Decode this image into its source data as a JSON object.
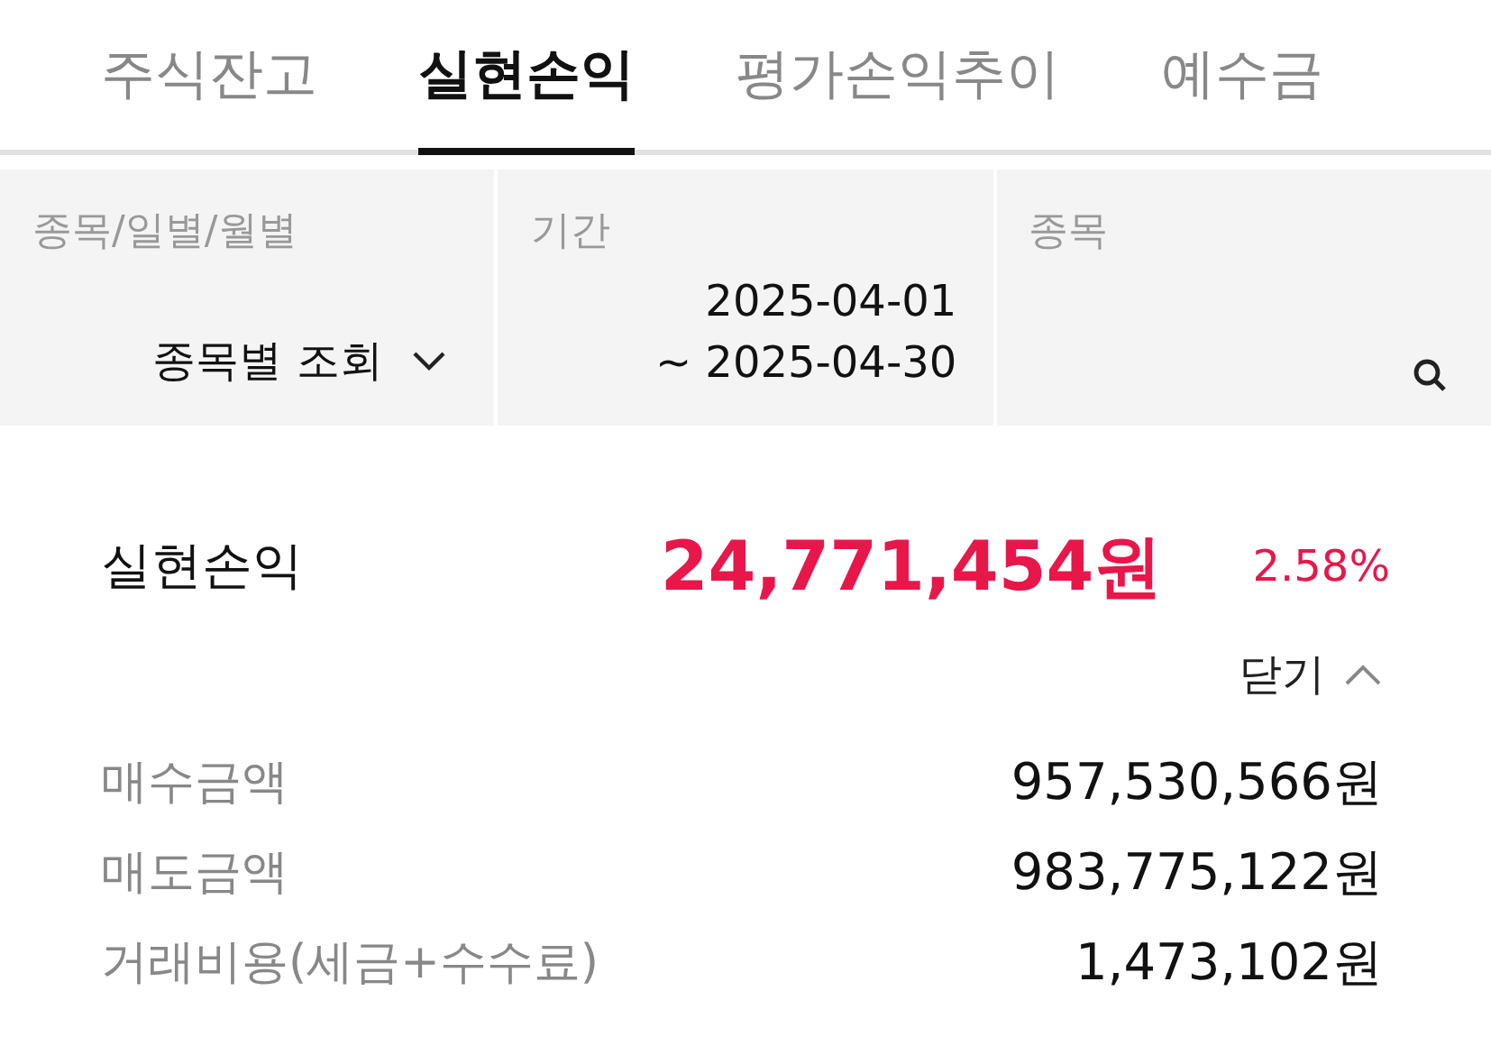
{
  "tabs": [
    {
      "label": "주식잔고",
      "selected": false
    },
    {
      "label": "실현손익",
      "selected": true
    },
    {
      "label": "평가손익추이",
      "selected": false
    },
    {
      "label": "예수금",
      "selected": false
    }
  ],
  "filters": [
    {
      "kind": "dropdown",
      "label": "종목/일별/월별",
      "value": "종목별 조회"
    },
    {
      "kind": "period",
      "label": "기간",
      "start": "2025-04-01",
      "end": "~ 2025-04-30"
    },
    {
      "kind": "search",
      "label": "종목"
    }
  ],
  "summary": {
    "label": "실현손익",
    "amount": "24,771,454원",
    "rate": "2.58%"
  },
  "toggle": {
    "label": "닫기",
    "expanded": true
  },
  "details": [
    {
      "label": "매수금액",
      "value": "957,530,566원"
    },
    {
      "label": "매도금액",
      "value": "983,775,122원"
    },
    {
      "label": "거래비용(세금+수수료)",
      "value": "1,473,102원"
    }
  ]
}
